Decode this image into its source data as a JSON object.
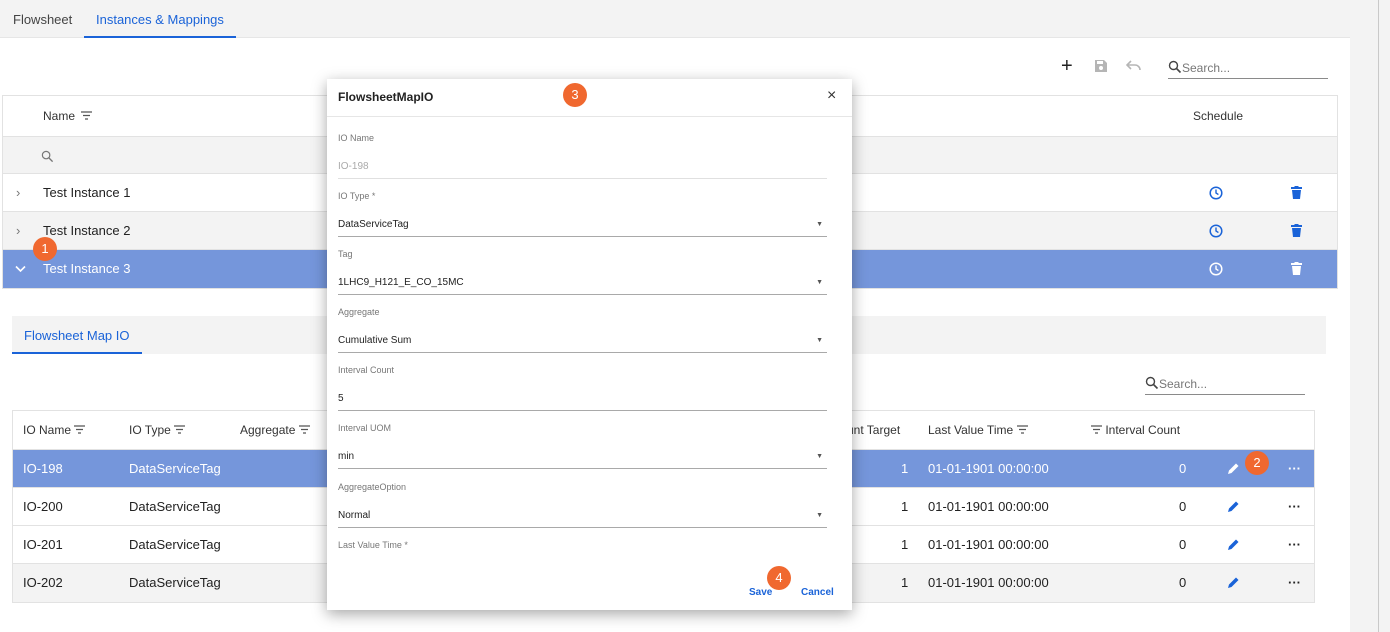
{
  "tabs": [
    {
      "label": "Flowsheet",
      "active": false
    },
    {
      "label": "Instances & Mappings",
      "active": true
    }
  ],
  "toolbar": {
    "add": "+",
    "search_placeholder": "Search..."
  },
  "instances_grid": {
    "columns": {
      "name": "Name",
      "schedule": "Schedule"
    },
    "rows": [
      {
        "name": "Test Instance 1",
        "expanded": false
      },
      {
        "name": "Test Instance 2",
        "expanded": false
      },
      {
        "name": "Test Instance 3",
        "expanded": true
      }
    ]
  },
  "subpanel": {
    "tab": "Flowsheet Map IO",
    "search_placeholder": "Search...",
    "columns": {
      "io_name": "IO Name",
      "io_type": "IO Type",
      "aggregate": "Aggregate",
      "count_target": "unt Target",
      "last_value_time": "Last Value Time",
      "interval_count": "Interval Count"
    },
    "rows": [
      {
        "io_name": "IO-198",
        "io_type": "DataServiceTag",
        "count_target": "1",
        "last_value_time": "01-01-1901 00:00:00",
        "interval_count": "0"
      },
      {
        "io_name": "IO-200",
        "io_type": "DataServiceTag",
        "count_target": "1",
        "last_value_time": "01-01-1901 00:00:00",
        "interval_count": "0"
      },
      {
        "io_name": "IO-201",
        "io_type": "DataServiceTag",
        "count_target": "1",
        "last_value_time": "01-01-1901 00:00:00",
        "interval_count": "0"
      },
      {
        "io_name": "IO-202",
        "io_type": "DataServiceTag",
        "count_target": "1",
        "last_value_time": "01-01-1901 00:00:00",
        "interval_count": "0"
      }
    ]
  },
  "modal": {
    "title": "FlowsheetMapIO",
    "close": "×",
    "fields": [
      {
        "label": "IO Name",
        "value": "IO-198"
      },
      {
        "label": "IO Type *",
        "value": "DataServiceTag"
      },
      {
        "label": "Tag",
        "value": "1LHC9_H121_E_CO_15MC"
      },
      {
        "label": "Aggregate",
        "value": "Cumulative Sum"
      },
      {
        "label": "Interval Count",
        "value": "5"
      },
      {
        "label": "Interval UOM",
        "value": "min"
      },
      {
        "label": "AggregateOption",
        "value": "Normal"
      },
      {
        "label": "Last Value Time *",
        "value": ""
      }
    ],
    "save": "Save",
    "cancel": "Cancel"
  },
  "badges": [
    "1",
    "2",
    "3",
    "4"
  ],
  "colors": {
    "accent": "#1a63d8",
    "selected_row": "#7596db",
    "badge": "#f0682f"
  },
  "icons": {
    "filter": "filter-icon",
    "schedule": "clock-icon",
    "delete": "trash-icon",
    "edit": "pencil-icon",
    "more": "more-icon"
  }
}
